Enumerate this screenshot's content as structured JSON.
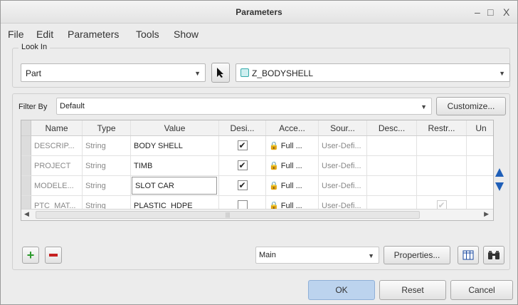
{
  "window": {
    "title": "Parameters",
    "minimize": "–",
    "maximize": "□",
    "close": "X"
  },
  "menu": [
    "File",
    "Edit",
    "Parameters",
    "Tools",
    "Show"
  ],
  "look_in": {
    "label": "Look In",
    "scope": "Part",
    "model": "Z_BODYSHELL"
  },
  "filter": {
    "label": "Filter By",
    "value": "Default",
    "customize": "Customize..."
  },
  "table": {
    "headers": [
      "Name",
      "Type",
      "Value",
      "Desi...",
      "Acce...",
      "Sour...",
      "Desc...",
      "Restr...",
      "Un"
    ],
    "rows": [
      {
        "name": "DESCRIP...",
        "type": "String",
        "value": "BODY SHELL",
        "designated": true,
        "access": "Full",
        "source": "User-Defi...",
        "restricted": false
      },
      {
        "name": "PROJECT",
        "type": "String",
        "value": "TIMB",
        "designated": true,
        "access": "Full",
        "source": "User-Defi...",
        "restricted": false
      },
      {
        "name": "MODELE...",
        "type": "String",
        "value": "SLOT CAR",
        "designated": true,
        "access": "Full",
        "source": "User-Defi...",
        "restricted": false
      },
      {
        "name": "PTC_MAT...",
        "type": "String",
        "value": "PLASTIC_HDPE",
        "designated": false,
        "access": "Full",
        "source": "User-Defi...",
        "restricted": true
      }
    ],
    "access_more": "...",
    "scroll_grip": "|||"
  },
  "bottom": {
    "view": "Main",
    "properties": "Properties..."
  },
  "buttons": {
    "ok": "OK",
    "reset": "Reset",
    "cancel": "Cancel"
  },
  "colors": {
    "ok_bg": "#bcd3ee",
    "add_green": "#2d9a2d",
    "remove_red": "#c62020",
    "arrow_blue": "#1f5fb8"
  }
}
